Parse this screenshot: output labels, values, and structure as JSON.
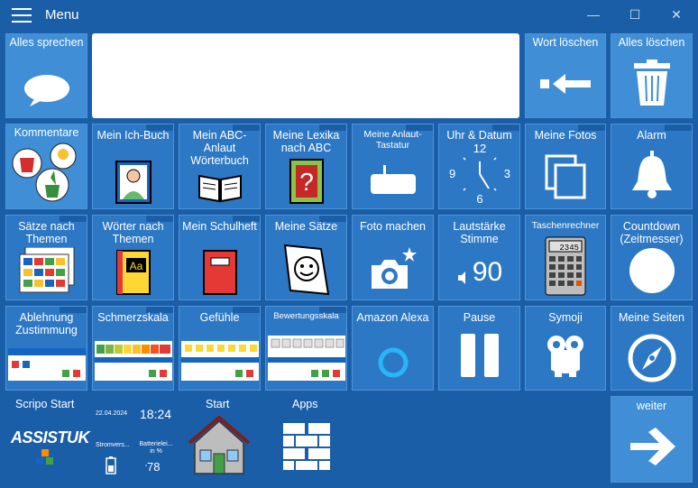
{
  "window": {
    "title": "Menu",
    "minimize": "—",
    "maximize": "☐",
    "close": "✕"
  },
  "top": {
    "speak_all": "Alles sprechen",
    "delete_word": "Wort löschen",
    "delete_all": "Alles löschen"
  },
  "tiles": {
    "kommentare": "Kommentare",
    "ich_buch": "Mein Ich-Buch",
    "abc_woerterbuch": "Mein ABC-Anlaut Wörterbuch",
    "lexika": "Meine Lexika nach ABC",
    "anlaut_tastatur": "Meine Anlaut-Tastatur",
    "uhr": "Uhr & Datum",
    "fotos": "Meine Fotos",
    "alarm": "Alarm",
    "saetze_themen": "Sätze nach Themen",
    "woerter_themen": "Wörter nach Themen",
    "schulheft": "Mein Schulheft",
    "meine_saetze": "Meine Sätze",
    "foto_machen": "Foto machen",
    "lautstaerke": "Lautstärke Stimme",
    "taschenrechner": "Taschenrechner",
    "countdown": "Countdown (Zeitmesser)",
    "ablehnung": "Ablehnung Zustimmung",
    "schmerzskala": "Schmerzskala",
    "gefuehle": "Gefühle",
    "bewertungsskala": "Bewertungsskala",
    "alexa": "Amazon Alexa",
    "pause": "Pause",
    "symoji": "Symoji",
    "meine_seiten": "Meine Seiten"
  },
  "clock": {
    "n12": "12",
    "n3": "3",
    "n6": "6",
    "n9": "9"
  },
  "volume_value": "90",
  "calculator_display": "2345",
  "bottom": {
    "scripo_start": "Scripo Start",
    "logo_text": "ASSISTUK",
    "date": "22.04.2024",
    "time": "18:24",
    "power_label": "Stromvers...",
    "battery_label": "Batterielei... in %",
    "battery_value": "78",
    "start": "Start",
    "apps": "Apps",
    "weiter": "weiter"
  },
  "colors": {
    "background": "#1a5ea8",
    "tile": "#2d78c4",
    "tile_light": "#3f8ed6",
    "white": "#ffffff"
  }
}
